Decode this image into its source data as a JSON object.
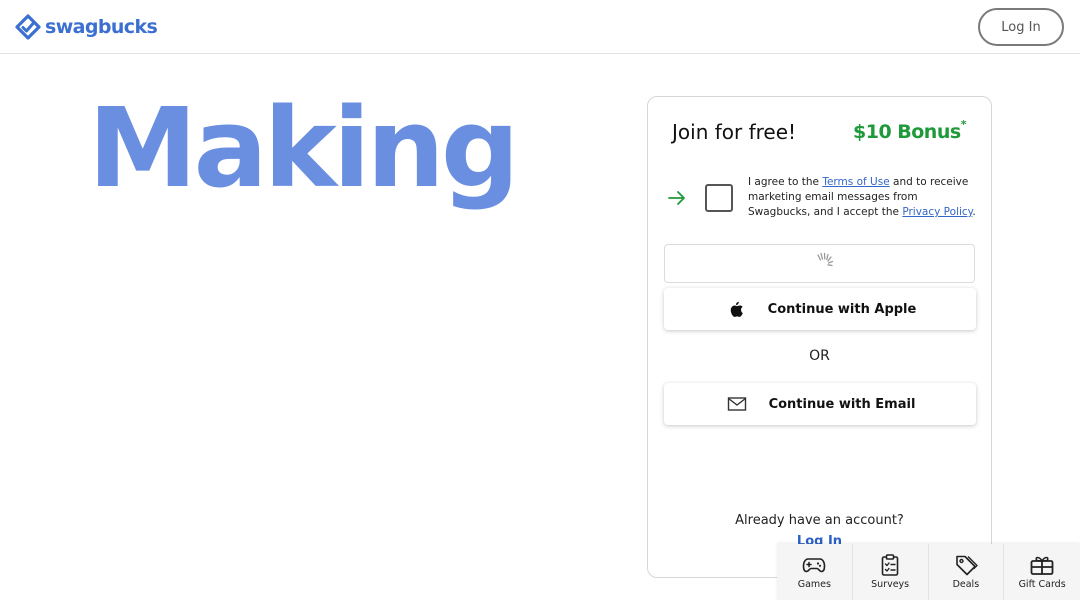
{
  "header": {
    "logo_text": "swagbucks",
    "login_label": "Log In"
  },
  "hero": {
    "headline": "Making"
  },
  "signup": {
    "title": "Join for free!",
    "bonus_text": "$10 Bonus",
    "bonus_mark": "*",
    "agreement": {
      "part1": "I agree to the ",
      "terms_link": "Terms of Use",
      "part2": " and to receive marketing email messages from Swagbucks, and I accept the ",
      "privacy_link": "Privacy Policy",
      "part3": "."
    },
    "apple_button": "Continue with Apple",
    "or_text": "OR",
    "email_button": "Continue with Email",
    "already_text": "Already have an account?",
    "login_link": "Log In"
  },
  "bottom_nav": [
    {
      "label": "Games",
      "icon": "gamepad-icon"
    },
    {
      "label": "Surveys",
      "icon": "clipboard-icon"
    },
    {
      "label": "Deals",
      "icon": "tags-icon"
    },
    {
      "label": "Gift Cards",
      "icon": "gift-card-icon"
    }
  ],
  "colors": {
    "brand_blue": "#3b6fd1",
    "hero_blue": "#6b8fe0",
    "bonus_green": "#1f9a3a",
    "link_blue": "#3266c7"
  }
}
